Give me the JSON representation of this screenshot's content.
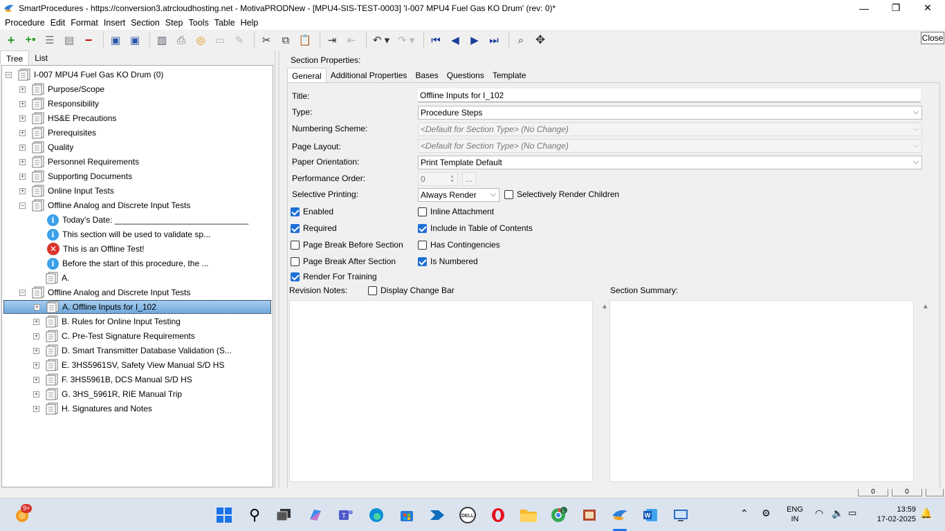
{
  "window": {
    "title": "SmartProcedures - https://conversion3.atrcloudhosting.net - MotivaPRODNew - [MPU4-SIS-TEST-0003] 'I-007 MPU4 Fuel Gas KO Drum' (rev: 0)*",
    "minimize": "—",
    "maximize": "❐",
    "close": "✕"
  },
  "menu": [
    "Procedure",
    "Edit",
    "Format",
    "Insert",
    "Section",
    "Step",
    "Tools",
    "Table",
    "Help"
  ],
  "toolbar": {
    "close_tooltip": "Close",
    "icons": [
      "add-icon",
      "add-child-icon",
      "outline-icon",
      "list-icon",
      "remove-icon",
      "save-all-icon",
      "save-icon",
      "export-icon",
      "print-icon",
      "link-icon",
      "image-icon",
      "pencil-icon",
      "cut-icon",
      "copy-icon",
      "paste-icon",
      "indent-icon",
      "outdent-icon",
      "undo-icon",
      "redo-icon",
      "first-icon",
      "previous-icon",
      "next-icon",
      "last-icon",
      "find-icon",
      "move-icon"
    ]
  },
  "left": {
    "tabs": [
      "Tree",
      "List"
    ],
    "root": "I-007 MPU4 Fuel Gas KO Drum (0)",
    "nodes": [
      {
        "label": "Purpose/Scope",
        "level": 1,
        "type": "section",
        "pm": "+"
      },
      {
        "label": "Responsibility",
        "level": 1,
        "type": "section",
        "pm": "+"
      },
      {
        "label": "HS&E Precautions",
        "level": 1,
        "type": "section",
        "pm": "+"
      },
      {
        "label": "Prerequisites",
        "level": 1,
        "type": "section",
        "pm": "+"
      },
      {
        "label": "Quality",
        "level": 1,
        "type": "section",
        "pm": "+"
      },
      {
        "label": "Personnel Requirements",
        "level": 1,
        "type": "section",
        "pm": "+"
      },
      {
        "label": "Supporting Documents",
        "level": 1,
        "type": "section",
        "pm": "+"
      },
      {
        "label": "Online Input Tests",
        "level": 1,
        "type": "section",
        "pm": "+"
      },
      {
        "label": "Offline Analog and Discrete Input Tests",
        "level": 1,
        "type": "section",
        "pm": "−"
      },
      {
        "label": "Today's Date: _____________________________",
        "level": 2,
        "type": "info"
      },
      {
        "label": "This section will be used to validate sp...",
        "level": 2,
        "type": "info"
      },
      {
        "label": "This is an Offline Test!",
        "level": 2,
        "type": "error"
      },
      {
        "label": "Before the start of this procedure, the ...",
        "level": 2,
        "type": "info"
      },
      {
        "label": "A.",
        "level": 1,
        "type": "section-nopm"
      },
      {
        "label": "Offline Analog and Discrete Input Tests",
        "level": 1,
        "type": "section",
        "pm": "−"
      },
      {
        "label": "A. Offline Inputs for I_102",
        "level": 2,
        "type": "section",
        "pm": "+",
        "selected": true
      },
      {
        "label": "B. Rules for Online Input Testing",
        "level": 2,
        "type": "section",
        "pm": "+"
      },
      {
        "label": "C. Pre-Test Signature Requirements",
        "level": 2,
        "type": "section",
        "pm": "+"
      },
      {
        "label": "D. Smart Transmitter Database Validation (S...",
        "level": 2,
        "type": "section",
        "pm": "+"
      },
      {
        "label": "E. 3HS5961SV, Safety View Manual S/D HS",
        "level": 2,
        "type": "section",
        "pm": "+"
      },
      {
        "label": "F. 3HS5961B, DCS Manual S/D HS",
        "level": 2,
        "type": "section",
        "pm": "+"
      },
      {
        "label": "G. 3HS_5961R, RIE Manual Trip",
        "level": 2,
        "type": "section",
        "pm": "+"
      },
      {
        "label": "H. Signatures and Notes",
        "level": 2,
        "type": "section",
        "pm": "+"
      }
    ]
  },
  "right": {
    "header": "Section Properties:",
    "tabs": [
      "General",
      "Additional Properties",
      "Bases",
      "Questions",
      "Template"
    ],
    "labels": {
      "title": "Title:",
      "type": "Type:",
      "numbering": "Numbering Scheme:",
      "layout": "Page Layout:",
      "orientation": "Paper Orientation:",
      "performance": "Performance Order:",
      "selective": "Selective Printing:",
      "revision_notes": "Revision Notes:",
      "section_summary": "Section Summary:"
    },
    "values": {
      "title": "Offline Inputs for I_102",
      "type": "Procedure Steps",
      "numbering": "<Default for Section Type> (No Change)",
      "layout": "<Default for Section Type> (No Change)",
      "orientation": "Print Template Default",
      "performance": "0",
      "performance_btn": "...",
      "selective": "Always Render"
    },
    "checkboxes": [
      {
        "label": "Selectively Render Children",
        "checked": false
      },
      {
        "label": "Enabled",
        "checked": true
      },
      {
        "label": "Inline Attachment",
        "checked": false
      },
      {
        "label": "Required",
        "checked": true
      },
      {
        "label": "Include in Table of Contents",
        "checked": true
      },
      {
        "label": "Page Break Before Section",
        "checked": false
      },
      {
        "label": "Has Contingencies",
        "checked": false
      },
      {
        "label": "Page Break After Section",
        "checked": false
      },
      {
        "label": "Is Numbered",
        "checked": true
      },
      {
        "label": "Render For Training",
        "checked": true
      },
      {
        "label": "Display Change Bar",
        "checked": false
      }
    ]
  },
  "status": {
    "box1": "0",
    "box2": "0"
  },
  "taskbar": {
    "badge": "9+",
    "lang1": "ENG",
    "lang2": "IN",
    "time": "13:59",
    "date": "17-02-2025",
    "apps": [
      "widgets-icon",
      "start-icon",
      "search-icon",
      "task-view-icon",
      "copilot-icon",
      "teams-icon",
      "edge-icon",
      "store-icon",
      "power-automate-icon",
      "dell-icon",
      "opera-icon",
      "file-explorer-icon",
      "chrome-icon",
      "remote-app-icon",
      "smartprocedures-icon",
      "word-icon",
      "rdp-icon"
    ]
  }
}
